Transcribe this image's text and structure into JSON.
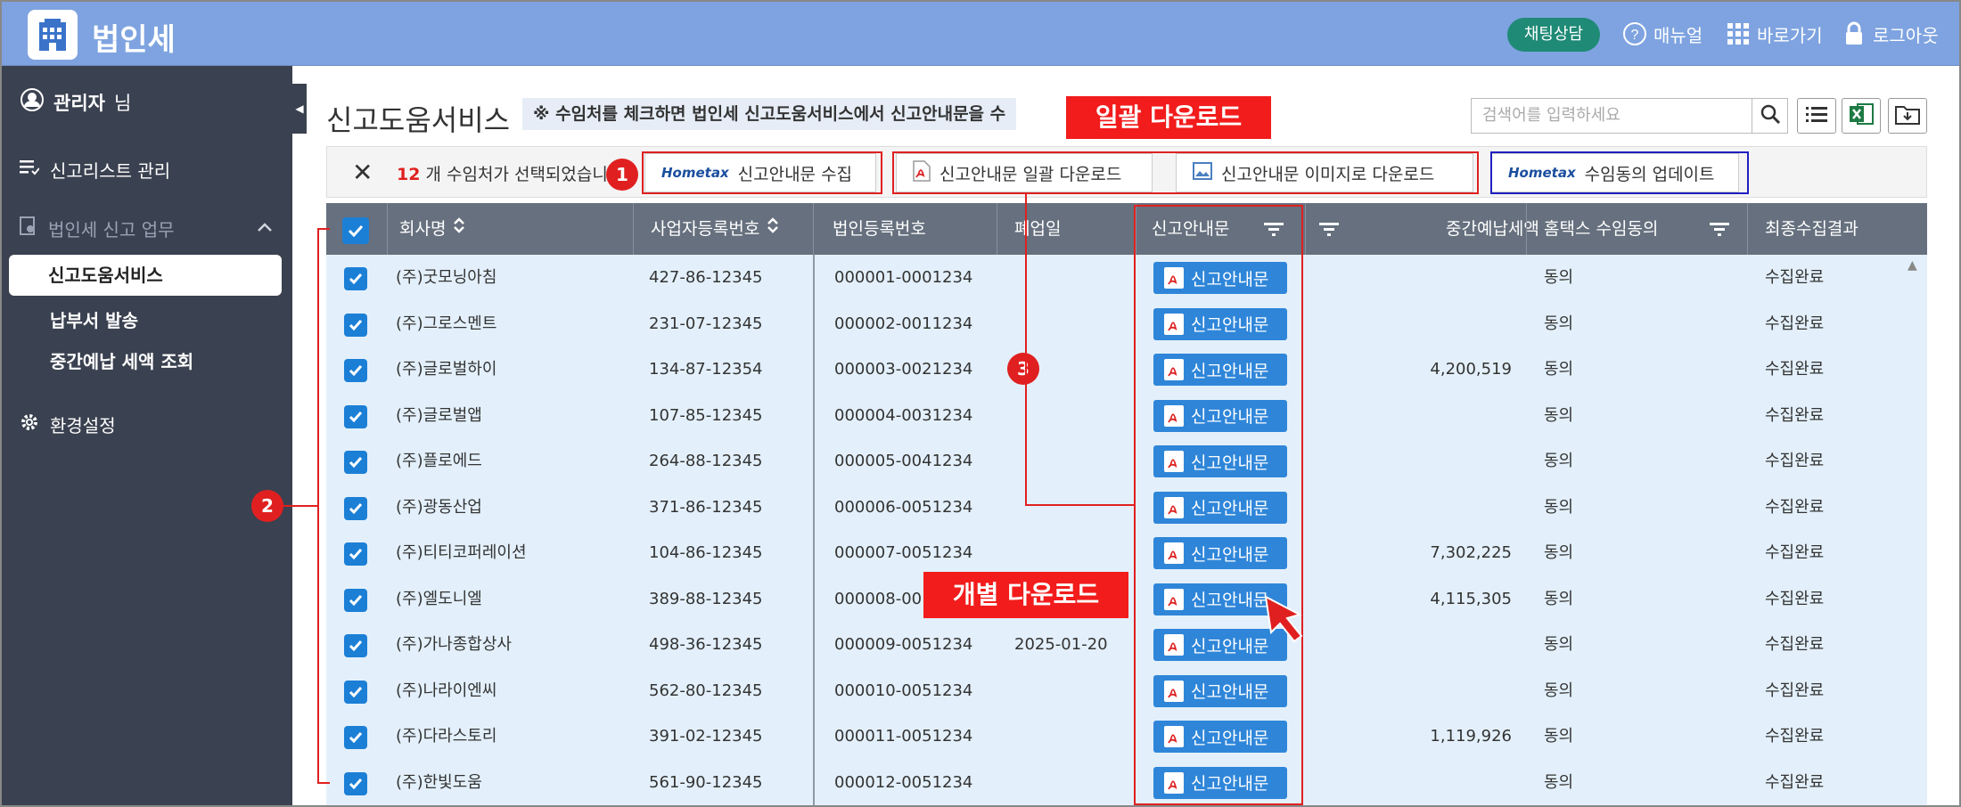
{
  "header": {
    "title": "법인세",
    "chat": "채팅상담",
    "manual": "매뉴얼",
    "shortcut": "바로가기",
    "logout": "로그아웃"
  },
  "sidebar": {
    "user_name": "관리자",
    "user_suffix": "님",
    "report_list": "신고리스트 관리",
    "section": "법인세 신고 업무",
    "active": "신고도움서비스",
    "sub1": "납부서 발송",
    "sub2": "중간예납 세액 조회",
    "settings": "환경설정"
  },
  "main": {
    "title": "신고도움서비스",
    "notice": "※ 수임처를 체크하면 법인세 신고도움서비스에서 신고안내문을 수",
    "search_placeholder": "검색어를 입력하세요",
    "selected_count": "12",
    "selected_text": " 개 수임처가 선택되었습니",
    "btn_collect": "신고안내문 수집",
    "btn_bulk_download": "신고안내문 일괄 다운로드",
    "btn_image_download": "신고안내문 이미지로 다운로드",
    "btn_consent_update": "수임동의 업데이트",
    "hometax_logo": "Hometax"
  },
  "table": {
    "headers": {
      "company": "회사명",
      "biz_no": "사업자등록번호",
      "corp_no": "법인등록번호",
      "closed": "폐업일",
      "guide": "신고안내문",
      "interim_tax": "중간예납세액",
      "consent": "홈택스 수임동의",
      "result": "최종수집결과"
    },
    "guide_label": "신고안내문",
    "rows": [
      {
        "company": "(주)굿모닝아침",
        "biz_no": "427-86-12345",
        "corp_no": "000001-0001234",
        "closed": "",
        "tax": "",
        "consent": "동의",
        "result": "수집완료"
      },
      {
        "company": "(주)그로스멘트",
        "biz_no": "231-07-12345",
        "corp_no": "000002-0011234",
        "closed": "",
        "tax": "",
        "consent": "동의",
        "result": "수집완료"
      },
      {
        "company": "(주)글로벌하이",
        "biz_no": "134-87-12354",
        "corp_no": "000003-0021234",
        "closed": "",
        "tax": "4,200,519",
        "consent": "동의",
        "result": "수집완료"
      },
      {
        "company": "(주)글로벌앱",
        "biz_no": "107-85-12345",
        "corp_no": "000004-0031234",
        "closed": "",
        "tax": "",
        "consent": "동의",
        "result": "수집완료"
      },
      {
        "company": "(주)플로에드",
        "biz_no": "264-88-12345",
        "corp_no": "000005-0041234",
        "closed": "",
        "tax": "",
        "consent": "동의",
        "result": "수집완료"
      },
      {
        "company": "(주)광동산업",
        "biz_no": "371-86-12345",
        "corp_no": "000006-0051234",
        "closed": "",
        "tax": "",
        "consent": "동의",
        "result": "수집완료"
      },
      {
        "company": "(주)티티코퍼레이션",
        "biz_no": "104-86-12345",
        "corp_no": "000007-0051234",
        "closed": "",
        "tax": "7,302,225",
        "consent": "동의",
        "result": "수집완료"
      },
      {
        "company": "(주)엘도니엘",
        "biz_no": "389-88-12345",
        "corp_no": "000008-00",
        "closed": "",
        "tax": "4,115,305",
        "consent": "동의",
        "result": "수집완료"
      },
      {
        "company": "(주)가나종합상사",
        "biz_no": "498-36-12345",
        "corp_no": "000009-0051234",
        "closed": "2025-01-20",
        "tax": "",
        "consent": "동의",
        "result": "수집완료"
      },
      {
        "company": "(주)나라이엔씨",
        "biz_no": "562-80-12345",
        "corp_no": "000010-0051234",
        "closed": "",
        "tax": "",
        "consent": "동의",
        "result": "수집완료"
      },
      {
        "company": "(주)다라스토리",
        "biz_no": "391-02-12345",
        "corp_no": "000011-0051234",
        "closed": "",
        "tax": "1,119,926",
        "consent": "동의",
        "result": "수집완료"
      },
      {
        "company": "(주)한빛도움",
        "biz_no": "561-90-12345",
        "corp_no": "000012-0051234",
        "closed": "",
        "tax": "",
        "consent": "동의",
        "result": "수집완료"
      }
    ]
  },
  "annotations": {
    "bulk_label": "일괄 다운로드",
    "individual_label": "개별 다운로드",
    "n1": "1",
    "n2": "2",
    "n3": "3"
  },
  "colors": {
    "header_bg": "#7ea3e0",
    "sidebar_bg": "#3a4150",
    "table_header_bg": "#66707e",
    "row_bg": "#e3f0fb",
    "accent_blue": "#2f86d9",
    "annotation_red": "#e02020"
  }
}
